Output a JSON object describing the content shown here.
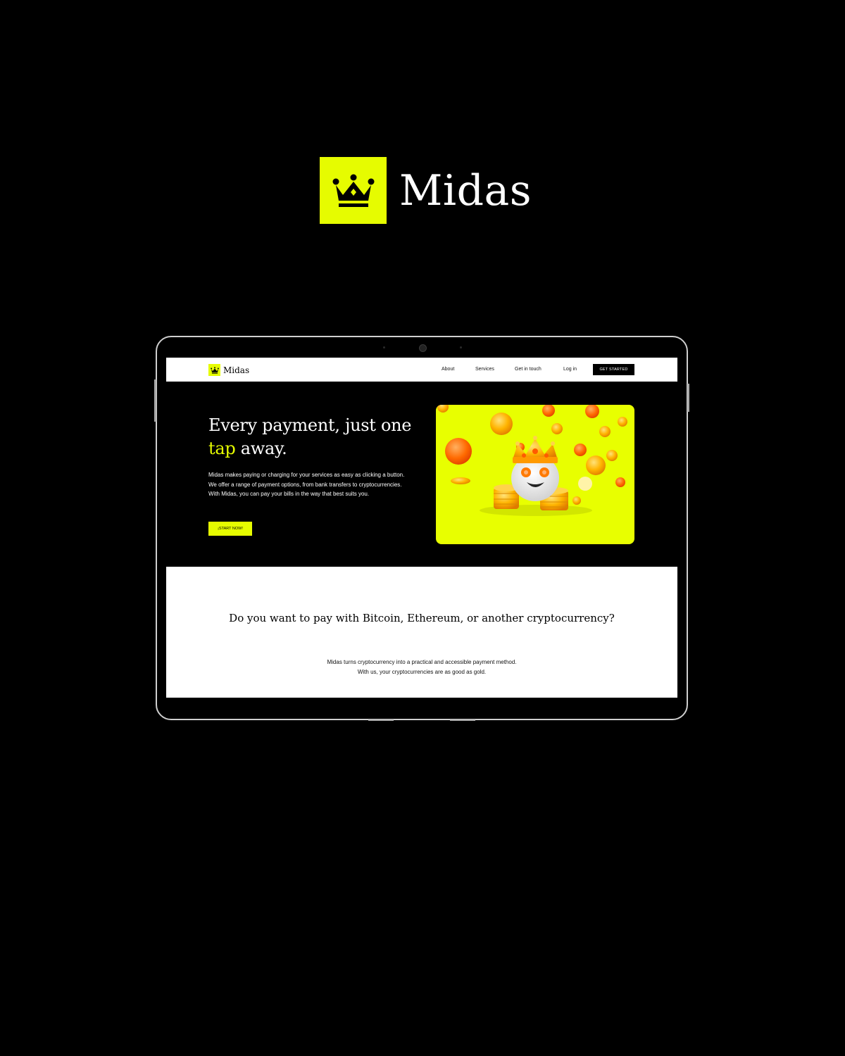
{
  "brand": {
    "name": "Midas",
    "icon": "crown-icon",
    "accent_color": "#e6fc00"
  },
  "nav": {
    "logo_text": "Midas",
    "links": [
      "About",
      "Services",
      "Get in touch",
      "Log in"
    ],
    "cta_label": "GET STARTED"
  },
  "hero": {
    "title_before": "Every payment, just one ",
    "title_highlight": "tap",
    "title_after": " away.",
    "body": "Midas makes paying or charging for your services as easy as clicking a button. We offer a range of payment options, from bank transfers to cryptocurrencies. With Midas, you can pay your bills in the way that best suits you.",
    "button_label": "¡START NOW!",
    "image": "crowned-mascot-with-gold-coins"
  },
  "crypto_section": {
    "title": "Do you want to pay with Bitcoin, Ethereum, or another cryptocurrency?",
    "body": "Midas turns cryptocurrency into a practical and accessible payment method. With us, your cryptocurrencies are as good as gold."
  }
}
